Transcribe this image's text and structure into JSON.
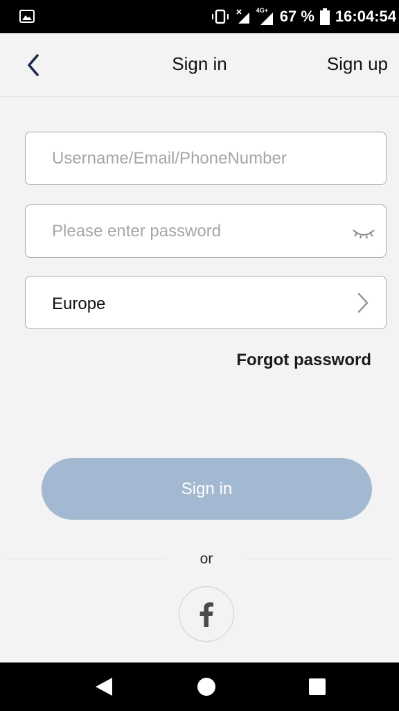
{
  "status_bar": {
    "battery_text": "67 %",
    "time": "16:04:54",
    "icons": [
      "gallery-icon",
      "vibrate-icon",
      "signal-icon",
      "signal-4g-icon",
      "battery-icon"
    ],
    "network_label": "4G+"
  },
  "header": {
    "title": "Sign in",
    "signup_label": "Sign up",
    "back_icon": "chevron-left-icon"
  },
  "form": {
    "username_placeholder": "Username/Email/PhoneNumber",
    "username_value": "",
    "password_placeholder": "Please enter password",
    "password_value": "",
    "password_toggle_icon": "eye-closed-icon",
    "region_value": "Europe",
    "region_icon": "chevron-right-icon",
    "forgot_label": "Forgot password",
    "signin_label": "Sign in"
  },
  "social": {
    "or_label": "or",
    "facebook_icon": "facebook-icon"
  },
  "nav_bar": {
    "icons": [
      "nav-back-icon",
      "nav-home-icon",
      "nav-recent-icon"
    ]
  },
  "colors": {
    "background": "#f3f3f3",
    "signin_button": "#a3b8d1",
    "header_text": "#111111",
    "back_arrow": "#1c2b4a",
    "placeholder": "#a6a6a6",
    "field_border": "#a9a9a9"
  }
}
